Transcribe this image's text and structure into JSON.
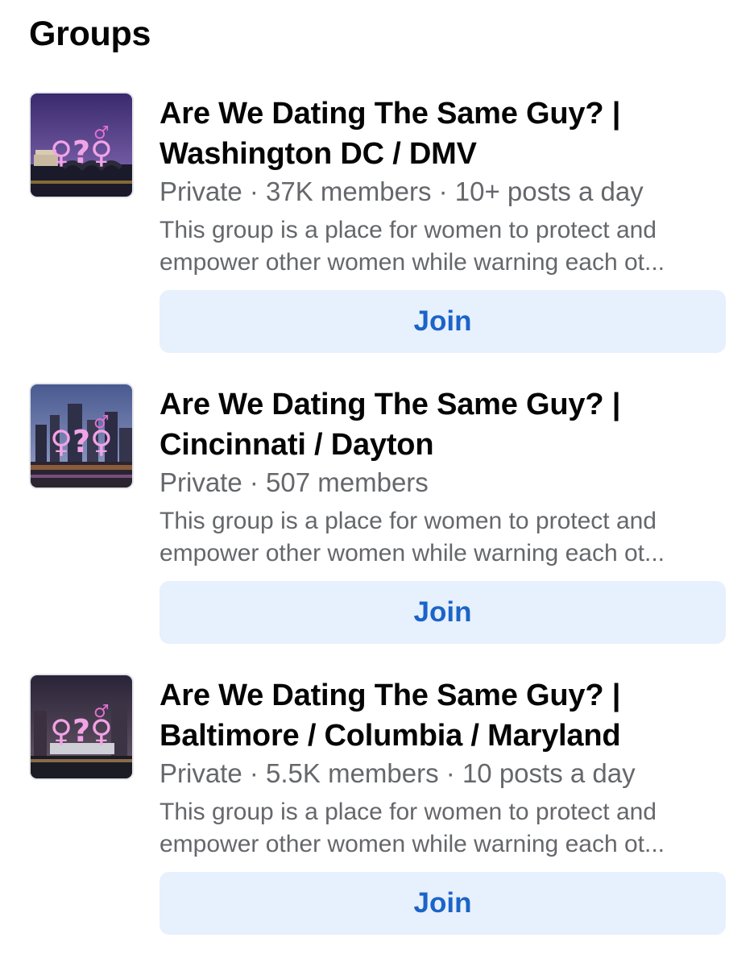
{
  "header": {
    "title": "Groups"
  },
  "groups": [
    {
      "name_line1": "Are We Dating The Same Guy? |",
      "name_line2": "Washington DC / DMV",
      "meta": "Private · 37K members · 10+ posts a day",
      "desc_line1": "This group is a place for women to protect and",
      "desc_line2": "empower other women while warning each ot...",
      "join_label": "Join",
      "symbols": "♀?♂♀",
      "colors": {
        "sky_top": "#3a2a6e",
        "sky_bottom": "#8a6fb8",
        "ground": "#1a1a2a"
      }
    },
    {
      "name_line1": "Are We Dating The Same Guy? |",
      "name_line2": "Cincinnati / Dayton",
      "meta": "Private · 507 members",
      "desc_line1": "This group is a place for women to protect and",
      "desc_line2": "empower other women while warning each ot...",
      "join_label": "Join",
      "symbols": "♀?♂♀",
      "colors": {
        "sky_top": "#4a5a90",
        "sky_bottom": "#9aa4cc",
        "ground": "#2b2430"
      }
    },
    {
      "name_line1": "Are We Dating The Same Guy? |",
      "name_line2": "Baltimore / Columbia / Maryland",
      "meta": "Private · 5.5K members · 10 posts a day",
      "desc_line1": "This group is a place for women to protect and",
      "desc_line2": "empower other women while warning each ot...",
      "join_label": "Join",
      "symbols": "♀?♂♀",
      "colors": {
        "sky_top": "#2a2438",
        "sky_bottom": "#6a5a6a",
        "ground": "#1c1c24"
      }
    }
  ],
  "theme": {
    "accent": "#1b64c8",
    "button_bg": "#e7f0fd",
    "secondary_text": "#65676b",
    "symbol_color": "#e88ad8"
  }
}
